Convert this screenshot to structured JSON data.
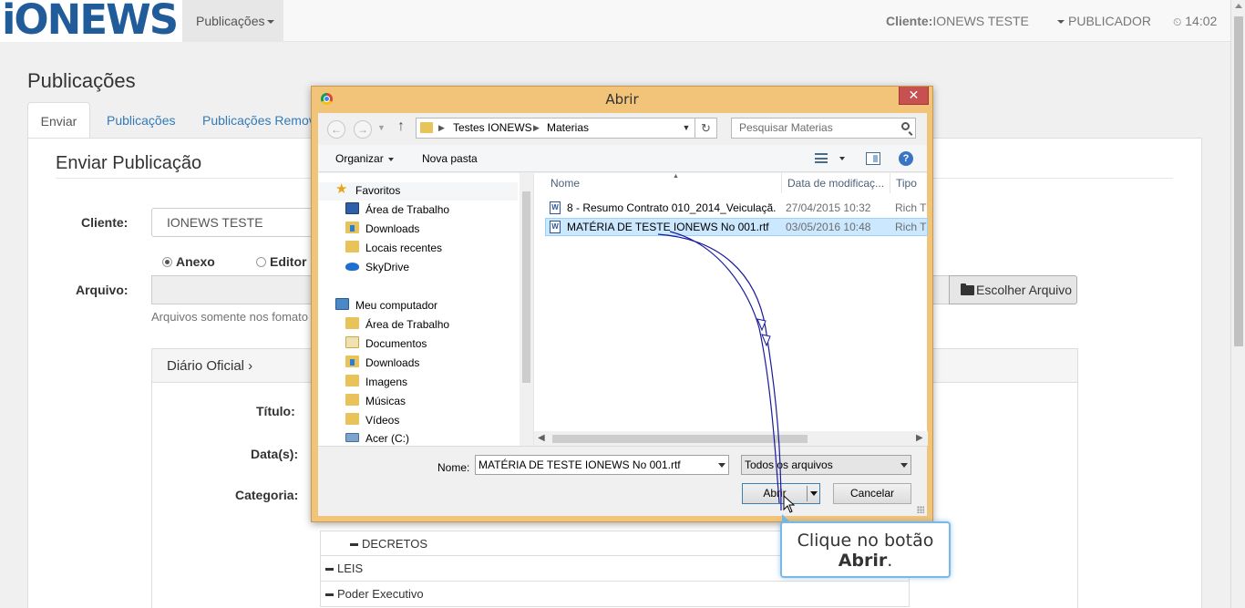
{
  "navbar": {
    "logo": "iONEWS",
    "pub_menu": "Publicações",
    "cliente_label": "Cliente:",
    "cliente_value": "IONEWS TESTE",
    "publicador": "PUBLICADOR",
    "time": "14:02"
  },
  "page": {
    "title": "Publicações",
    "tabs": [
      "Enviar",
      "Publicações",
      "Publicações Removi"
    ],
    "section_title": "Enviar Publicação",
    "labels": {
      "cliente": "Cliente:",
      "arquivo": "Arquivo:",
      "titulo": "Título:",
      "datas": "Data(s):",
      "categoria": "Categoria:"
    },
    "cliente_value": "IONEWS TESTE",
    "radio_anexo": "Anexo",
    "radio_editor": "Editor",
    "escolher_btn": "Escolher Arquivo",
    "help_text": "Arquivos somente nos fomato",
    "diario_title": "Diário Oficial ›",
    "tree_items": [
      "DECRETOS",
      "LEIS",
      "Poder Executivo"
    ]
  },
  "dialog": {
    "title": "Abrir",
    "close": "✕",
    "path": [
      "Testes IONEWS",
      "Materias"
    ],
    "search_placeholder": "Pesquisar Materias",
    "toolbar": {
      "organizar": "Organizar",
      "nova_pasta": "Nova pasta",
      "help": "?"
    },
    "nav": {
      "favorites_header": "Favoritos",
      "favorites": [
        "Área de Trabalho",
        "Downloads",
        "Locais recentes",
        "SkyDrive"
      ],
      "computer_header": "Meu computador",
      "computer": [
        "Área de Trabalho",
        "Documentos",
        "Downloads",
        "Imagens",
        "Músicas",
        "Vídeos",
        "Acer (C:)"
      ]
    },
    "columns": {
      "nome": "Nome",
      "data": "Data de modificaç...",
      "tipo": "Tipo"
    },
    "files": [
      {
        "name": "8 - Resumo Contrato 010_2014_Veiculaçã...",
        "date": "27/04/2015 10:32",
        "type": "Rich T",
        "selected": false
      },
      {
        "name": "MATÉRIA DE TESTE IONEWS No 001.rtf",
        "date": "03/05/2016 10:48",
        "type": "Rich T",
        "selected": true
      }
    ],
    "nome_label": "Nome:",
    "nome_value": "MATÉRIA DE TESTE IONEWS No 001.rtf",
    "tipo_value": "Todos os arquivos",
    "abrir": "Abrir",
    "cancelar": "Cancelar"
  },
  "callout": {
    "line1": "Clique no botão",
    "line2": "Abrir",
    "line2_suffix": "."
  },
  "colors": {
    "accent": "#337ab7",
    "dialog_frame": "#f2c47a",
    "close": "#c75050",
    "selection": "#cce8ff",
    "path": "#1a1a9c"
  }
}
